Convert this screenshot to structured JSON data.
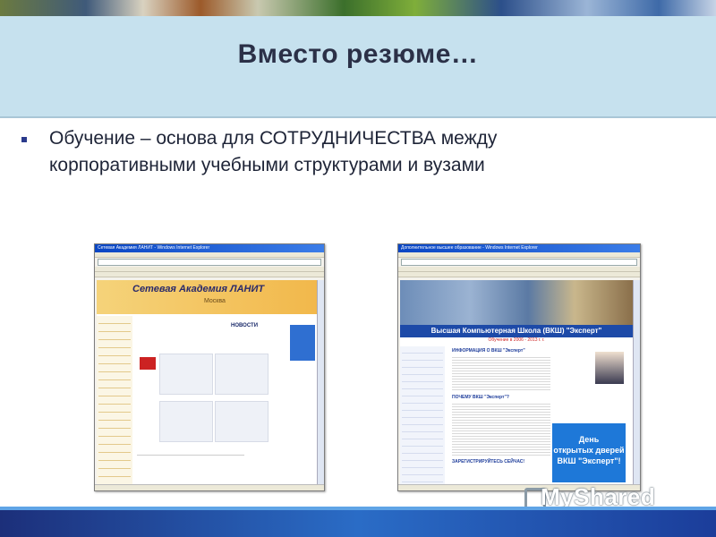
{
  "slide": {
    "title": "Вместо резюме…",
    "bullet": {
      "line1": "Обучение – основа для СОТРУДНИЧЕСТВА между",
      "line2": "корпоративными учебными структурами и вузами"
    }
  },
  "screenshot_left": {
    "window_title": "Сетевая Академия ЛАНИТ - Windows Internet Explorer",
    "site_name": "Сетевая Академия ЛАНИТ",
    "site_city": "Москва",
    "news_heading": "НОВОСТИ"
  },
  "screenshot_right": {
    "window_title": "Дополнительное высшее образование - Windows Internet Explorer",
    "banner": "Высшая Компьютерная Школа (ВКШ) \"Эксперт\"",
    "sub_banner": "Обучение в 2006 - 2013 г. г.",
    "section_info": "ИНФОРМАЦИЯ О ВКШ \"Эксперт\"",
    "section_why": "ПОЧЕМУ ВКШ \"Эксперт\"?",
    "section_register": "ЗАРЕГИСТРИРУЙТЕСЬ СЕЙЧАС!",
    "ad_line1": "День",
    "ad_line2": "открытых дверей",
    "ad_line3": "ВКШ \"Эксперт\"!"
  },
  "watermark": "MyShared"
}
